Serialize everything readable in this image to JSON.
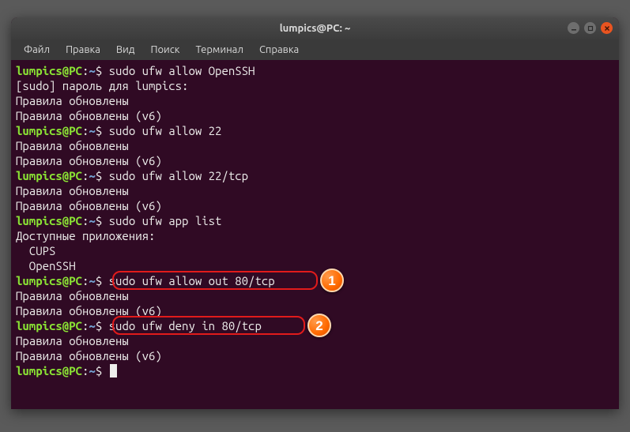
{
  "window": {
    "title": "lumpics@PC: ~"
  },
  "menu": {
    "file": "Файл",
    "edit": "Правка",
    "view": "Вид",
    "search": "Поиск",
    "terminal": "Терминал",
    "help": "Справка"
  },
  "prompt": {
    "user_host": "lumpics@PC",
    "colon": ":",
    "path": "~",
    "symbol": "$"
  },
  "lines": {
    "cmd1": "sudo ufw allow OpenSSH",
    "out_sudo": "[sudo] пароль для lumpics:",
    "out_updated": "Правила обновлены",
    "out_updated_v6": "Правила обновлены (v6)",
    "cmd2": "sudo ufw allow 22",
    "cmd3": "sudo ufw allow 22/tcp",
    "cmd4": "sudo ufw app list",
    "out_apps_header": "Доступные приложения:",
    "out_app_cups": "  CUPS",
    "out_app_openssh": "  OpenSSH",
    "cmd5": "sudo ufw allow out 80/tcp",
    "cmd6": "sudo ufw deny in 80/tcp"
  },
  "annotations": {
    "badge1": "1",
    "badge2": "2"
  },
  "colors": {
    "terminal_bg": "#300a24",
    "prompt_user": "#8ae234",
    "prompt_path": "#729fcf",
    "highlight_border": "#e11b1b",
    "badge_bg": "#ff6a00",
    "close_btn": "#e95420"
  }
}
